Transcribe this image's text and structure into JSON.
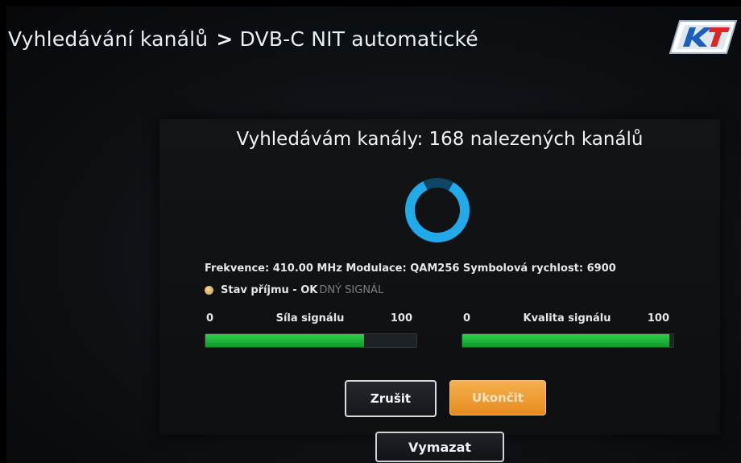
{
  "header": {
    "breadcrumb_section": "Vyhledávání kanálů",
    "breadcrumb_separator": ">",
    "breadcrumb_page": "DVB-C NIT automatické"
  },
  "logo": {
    "icon": "kt-logo"
  },
  "dialog": {
    "title": "Vyhledávám kanály: 168 nalezených kanálů",
    "spinner_icon": "loading-spinner-icon",
    "tuning_info": "Frekvence: 410.00 MHz Modulace: QAM256 Symbolová rychlost: 6900",
    "status": {
      "icon": "status-dot-icon",
      "label": "Stav příjmu - OK",
      "ghost_text": "DNÝ SIGNÁL"
    },
    "signal_strength": {
      "min": "0",
      "label": "Síla signálu",
      "max": "100",
      "level": 0.75
    },
    "signal_quality": {
      "min": "0",
      "label": "Kvalita signálu",
      "max": "100",
      "level": 0.98
    },
    "buttons": {
      "cancel": "Zrušit",
      "finish": "Ukončit"
    }
  },
  "footer": {
    "clear": "Vymazat"
  },
  "colors": {
    "accent_blue": "#1fa3e6",
    "signal_green": "#1fc23c",
    "button_orange": "#f0a038"
  }
}
